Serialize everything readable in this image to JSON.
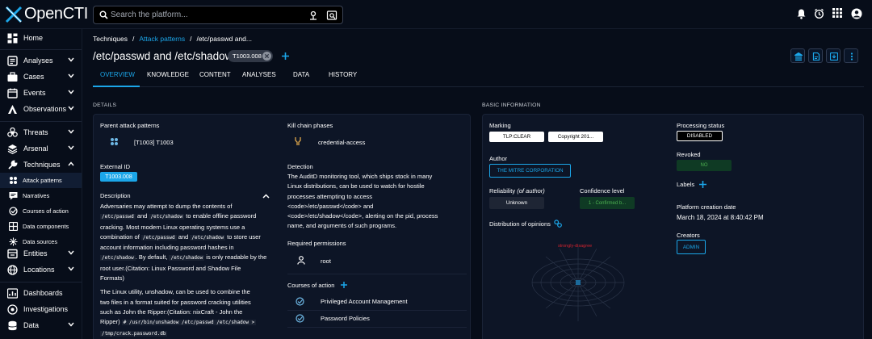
{
  "app": {
    "logo_text": "OpenCTI"
  },
  "search": {
    "placeholder": "Search the platform..."
  },
  "nav": {
    "home": "Home",
    "analyses": "Analyses",
    "cases": "Cases",
    "events": "Events",
    "observations": "Observations",
    "threats": "Threats",
    "arsenal": "Arsenal",
    "techniques": "Techniques",
    "attack_patterns": "Attack patterns",
    "narratives": "Narratives",
    "courses_of_action": "Courses of action",
    "data_components": "Data components",
    "data_sources": "Data sources",
    "entities": "Entities",
    "locations": "Locations",
    "dashboards": "Dashboards",
    "investigations": "Investigations",
    "data": "Data"
  },
  "breadcrumb": {
    "root": "Techniques",
    "sep": "/",
    "parent": "Attack patterns",
    "current": "/etc/passwd and..."
  },
  "entity": {
    "title": "/etc/passwd and /etc/shadow",
    "external_id_chip": "T1003.008"
  },
  "tabs": [
    "OVERVIEW",
    "KNOWLEDGE",
    "CONTENT",
    "ANALYSES",
    "DATA",
    "HISTORY"
  ],
  "details": {
    "section_title": "DETAILS",
    "parent_label": "Parent attack patterns",
    "parent_value": "[T1003] T1003",
    "kill_chain_label": "Kill chain phases",
    "kill_chain_value": "credential-access",
    "external_id_label": "External ID",
    "external_id_value": "T1003.008",
    "description_label": "Description",
    "desc": {
      "l1": "Adversaries may attempt to dump the contents of",
      "c1": "/etc/passwd",
      "and1": " and ",
      "c2": "/etc/shadow",
      "l2": " to enable offline password",
      "l3": "cracking. Most modern Linux operating systems use a",
      "l4a": "combination of ",
      "c3": "/etc/passwd",
      "and2": " and ",
      "c4": "/etc/shadow",
      "l4b": " to store user",
      "l5": "account information including password hashes in",
      "c5": "/etc/shadow",
      "l6a": ". By default, ",
      "c6": "/etc/shadow",
      "l6b": " is only readable by the",
      "l7": "root user.(Citation: Linux Password and Shadow File",
      "l8": "Formats)",
      "p2l1": "The Linux utility, unshadow, can be used to combine the",
      "p2l2": "two files in a format suited for password cracking utilities",
      "p2l3": "such as John the Ripper:(Citation: nixCraft - John the",
      "p2l4a": "Ripper) ",
      "c7": "# /usr/bin/unshadow /etc/passwd /etc/shadow >",
      "c8": "/tmp/crack.password.db"
    },
    "detection_label": "Detection",
    "detection": {
      "l1": "The AuditD monitoring tool, which ships stock in many",
      "l2": "Linux distributions, can be used to watch for hostile",
      "l3": "processes attempting to access",
      "l4": "<code>/etc/passwd</code> and",
      "l5": "<code>/etc/shadow</code>, alerting on the pid, process",
      "l6": "name, and arguments of such programs."
    },
    "permissions_label": "Required permissions",
    "permission_value": "root",
    "courses_label": "Courses of action",
    "courses": [
      "Privileged Account Management",
      "Password Policies"
    ]
  },
  "basic": {
    "section_title": "BASIC INFORMATION",
    "marking_label": "Marking",
    "markings": [
      "TLP:CLEAR",
      "Copyright 201..."
    ],
    "processing_label": "Processing status",
    "processing_value": "DISABLED",
    "author_label": "Author",
    "author_value": "THE MITRE CORPORATION",
    "revoked_label": "Revoked",
    "revoked_value": "NO",
    "reliability_label": "Reliability",
    "reliability_suffix": "(of author)",
    "reliability_value": "Unknown",
    "confidence_label": "Confidence level",
    "confidence_value": "1 - Confirmed b...",
    "labels_label": "Labels",
    "opinions_label": "Distribution of opinions",
    "radar_label": "strongly-disagree",
    "creation_label": "Platform creation date",
    "creation_value": "March 18, 2024 at 8:40:42 PM",
    "creators_label": "Creators",
    "creators_value": "ADMIN"
  },
  "colors": {
    "accent": "#1ba6e9",
    "bg": "#070d19",
    "panel": "#0d1526",
    "radar_label": "#d3232f",
    "revoked_bg": "#0f3a24",
    "revoked_fg": "#4caf50"
  }
}
